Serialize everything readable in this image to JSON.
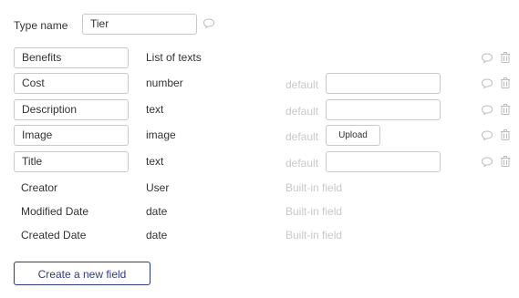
{
  "type_header": {
    "label": "Type name",
    "value": "Tier"
  },
  "fields": [
    {
      "name": "Benefits",
      "type": "List of texts",
      "default_label": "",
      "default_kind": "none"
    },
    {
      "name": "Cost",
      "type": "number",
      "default_label": "default",
      "default_kind": "input"
    },
    {
      "name": "Description",
      "type": "text",
      "default_label": "default",
      "default_kind": "input"
    },
    {
      "name": "Image",
      "type": "image",
      "default_label": "default",
      "default_kind": "upload",
      "upload_label": "Upload"
    },
    {
      "name": "Title",
      "type": "text",
      "default_label": "default",
      "default_kind": "input"
    }
  ],
  "builtin_fields": [
    {
      "name": "Creator",
      "type": "User",
      "note": "Built-in field"
    },
    {
      "name": "Modified Date",
      "type": "date",
      "note": "Built-in field"
    },
    {
      "name": "Created Date",
      "type": "date",
      "note": "Built-in field"
    }
  ],
  "create_button_label": "Create a new field",
  "icons": {
    "comment": "speech-bubble-icon",
    "delete": "trash-icon"
  },
  "colors": {
    "accent": "#2d3a8c",
    "muted": "#c8c8c8",
    "border": "#c9c9c9"
  }
}
